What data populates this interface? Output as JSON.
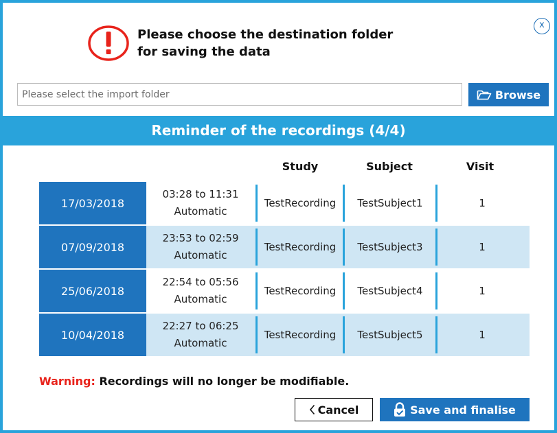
{
  "dialog": {
    "close_label": "x",
    "title_line1": "Please choose the destination folder",
    "title_line2": "for saving the data",
    "import_folder": {
      "value": "",
      "placeholder": "Please select the import folder"
    },
    "browse_label": "Browse",
    "reminder_title": "Reminder of the recordings (4/4)"
  },
  "table": {
    "columns": [
      "Study",
      "Subject",
      "Visit"
    ],
    "rows": [
      {
        "date": "17/03/2018",
        "time": "03:28 to 11:31",
        "mode": "Automatic",
        "study": "TestRecording",
        "subject": "TestSubject1",
        "visit": "1"
      },
      {
        "date": "07/09/2018",
        "time": "23:53 to 02:59",
        "mode": "Automatic",
        "study": "TestRecording",
        "subject": "TestSubject3",
        "visit": "1"
      },
      {
        "date": "25/06/2018",
        "time": "22:54 to 05:56",
        "mode": "Automatic",
        "study": "TestRecording",
        "subject": "TestSubject4",
        "visit": "1"
      },
      {
        "date": "10/04/2018",
        "time": "22:27 to 06:25",
        "mode": "Automatic",
        "study": "TestRecording",
        "subject": "TestSubject5",
        "visit": "1"
      }
    ]
  },
  "footer": {
    "warning_label": "Warning:",
    "warning_text": "Recordings will no longer be modifiable.",
    "cancel_label": "Cancel",
    "save_label": "Save and finalise"
  },
  "icons": {
    "close": "close-icon",
    "warning": "exclamation-circle-icon",
    "browse": "folder-open-icon",
    "cancel": "chevron-left-icon",
    "save": "lock-icon"
  },
  "colors": {
    "accent": "#29a3db",
    "primary": "#1f74be",
    "row_alt": "#cfe6f4",
    "warning": "#e8231b"
  }
}
